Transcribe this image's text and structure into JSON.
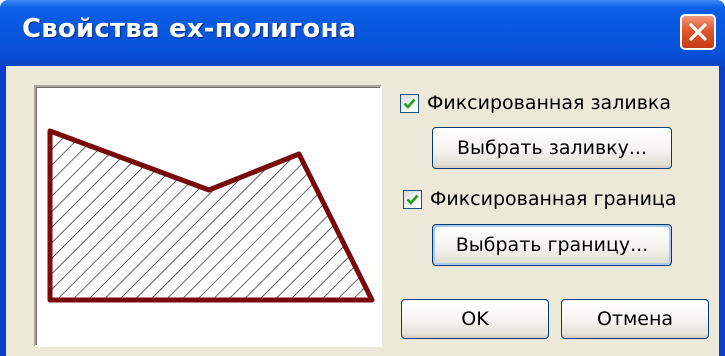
{
  "dialog": {
    "title": "Свойства ex-полигона",
    "close_label": "×"
  },
  "options": {
    "fixed_fill": {
      "label": "Фиксированная заливка",
      "checked": true
    },
    "choose_fill_label": "Выбрать заливку...",
    "fixed_border": {
      "label": "Фиксированная граница",
      "checked": true
    },
    "choose_border_label": "Выбрать границу..."
  },
  "buttons": {
    "ok_label": "OK",
    "cancel_label": "Отмена"
  },
  "preview": {
    "border_color": "#7a0a0a",
    "hatch_color": "#000000"
  },
  "colors": {
    "titlebar": "#0a56de",
    "close": "#e0562e",
    "face": "#ece9d8",
    "check": "#21a121"
  }
}
